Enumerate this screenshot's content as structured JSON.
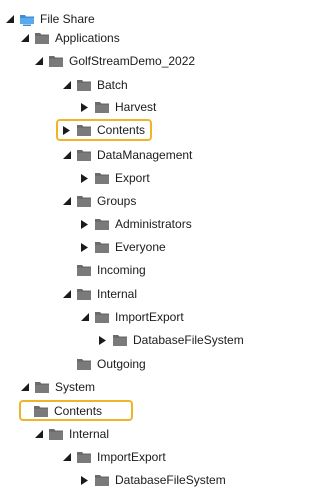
{
  "tree": {
    "nodes": [
      {
        "label": "File Share",
        "state": "expanded",
        "root": true
      },
      {
        "label": "Applications",
        "state": "expanded"
      },
      {
        "label": "GolfStreamDemo_2022",
        "state": "expanded"
      },
      {
        "label": "Batch",
        "state": "expanded"
      },
      {
        "label": "Harvest",
        "state": "collapsed"
      },
      {
        "label": "Contents",
        "state": "collapsed",
        "highlighted": true
      },
      {
        "label": "DataManagement",
        "state": "expanded"
      },
      {
        "label": "Export",
        "state": "collapsed"
      },
      {
        "label": "Groups",
        "state": "expanded"
      },
      {
        "label": "Administrators",
        "state": "collapsed"
      },
      {
        "label": "Everyone",
        "state": "collapsed"
      },
      {
        "label": "Incoming",
        "state": "leaf"
      },
      {
        "label": "Internal",
        "state": "expanded"
      },
      {
        "label": "ImportExport",
        "state": "expanded"
      },
      {
        "label": "DatabaseFileSystem",
        "state": "collapsed"
      },
      {
        "label": "Outgoing",
        "state": "leaf"
      },
      {
        "label": "System",
        "state": "expanded"
      },
      {
        "label": "Contents",
        "state": "leaf",
        "highlighted": true
      },
      {
        "label": "Internal",
        "state": "expanded"
      },
      {
        "label": "ImportExport",
        "state": "expanded"
      },
      {
        "label": "DatabaseFileSystem",
        "state": "collapsed"
      }
    ]
  },
  "colors": {
    "highlight_border": "#f0b429",
    "folder_fill": "#6b6b6b",
    "root_folder_fill": "#3a8fd6",
    "toggle_fill": "#1b1b1b"
  },
  "icons": {
    "expanded": "triangle-down-icon",
    "collapsed": "triangle-right-icon",
    "folder": "folder-icon",
    "root": "network-folder-icon"
  }
}
